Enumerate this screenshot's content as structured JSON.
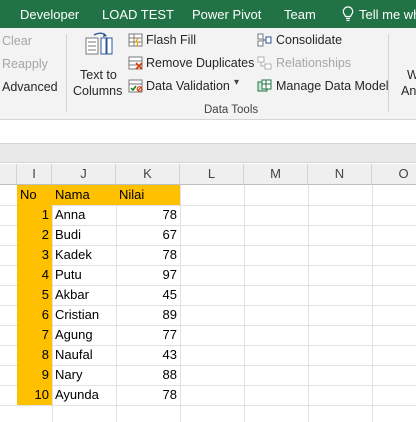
{
  "tabs": [
    "Developer",
    "LOAD TEST",
    "Power Pivot",
    "Team"
  ],
  "tell_me": "Tell me wh",
  "ribbon": {
    "left_cmds": [
      "Clear",
      "Reapply",
      "Advanced"
    ],
    "text_to_columns": [
      "Text to",
      "Columns"
    ],
    "flash_fill": "Flash Fill",
    "remove_duplicates": "Remove Duplicates",
    "data_validation": "Data Validation",
    "consolidate": "Consolidate",
    "relationships": "Relationships",
    "manage_data_model": "Manage Data Model",
    "group_label": "Data Tools",
    "right_cut": [
      "W",
      "An"
    ]
  },
  "columns": [
    "I",
    "J",
    "K",
    "L",
    "M",
    "N",
    "O"
  ],
  "headers": [
    "No",
    "Nama",
    "Nilai"
  ],
  "rows": [
    {
      "no": "1",
      "nama": "Anna",
      "nilai": "78"
    },
    {
      "no": "2",
      "nama": "Budi",
      "nilai": "67"
    },
    {
      "no": "3",
      "nama": "Kadek",
      "nilai": "78"
    },
    {
      "no": "4",
      "nama": "Putu",
      "nilai": "97"
    },
    {
      "no": "5",
      "nama": "Akbar",
      "nilai": "45"
    },
    {
      "no": "6",
      "nama": "Cristian",
      "nilai": "89"
    },
    {
      "no": "7",
      "nama": "Agung",
      "nilai": "77"
    },
    {
      "no": "8",
      "nama": "Naufal",
      "nilai": "43"
    },
    {
      "no": "9",
      "nama": "Nary",
      "nilai": "88"
    },
    {
      "no": "10",
      "nama": "Ayunda",
      "nilai": "78"
    }
  ],
  "colors": {
    "ribbon_tab": "#217346",
    "highlight": "#ffc000"
  }
}
